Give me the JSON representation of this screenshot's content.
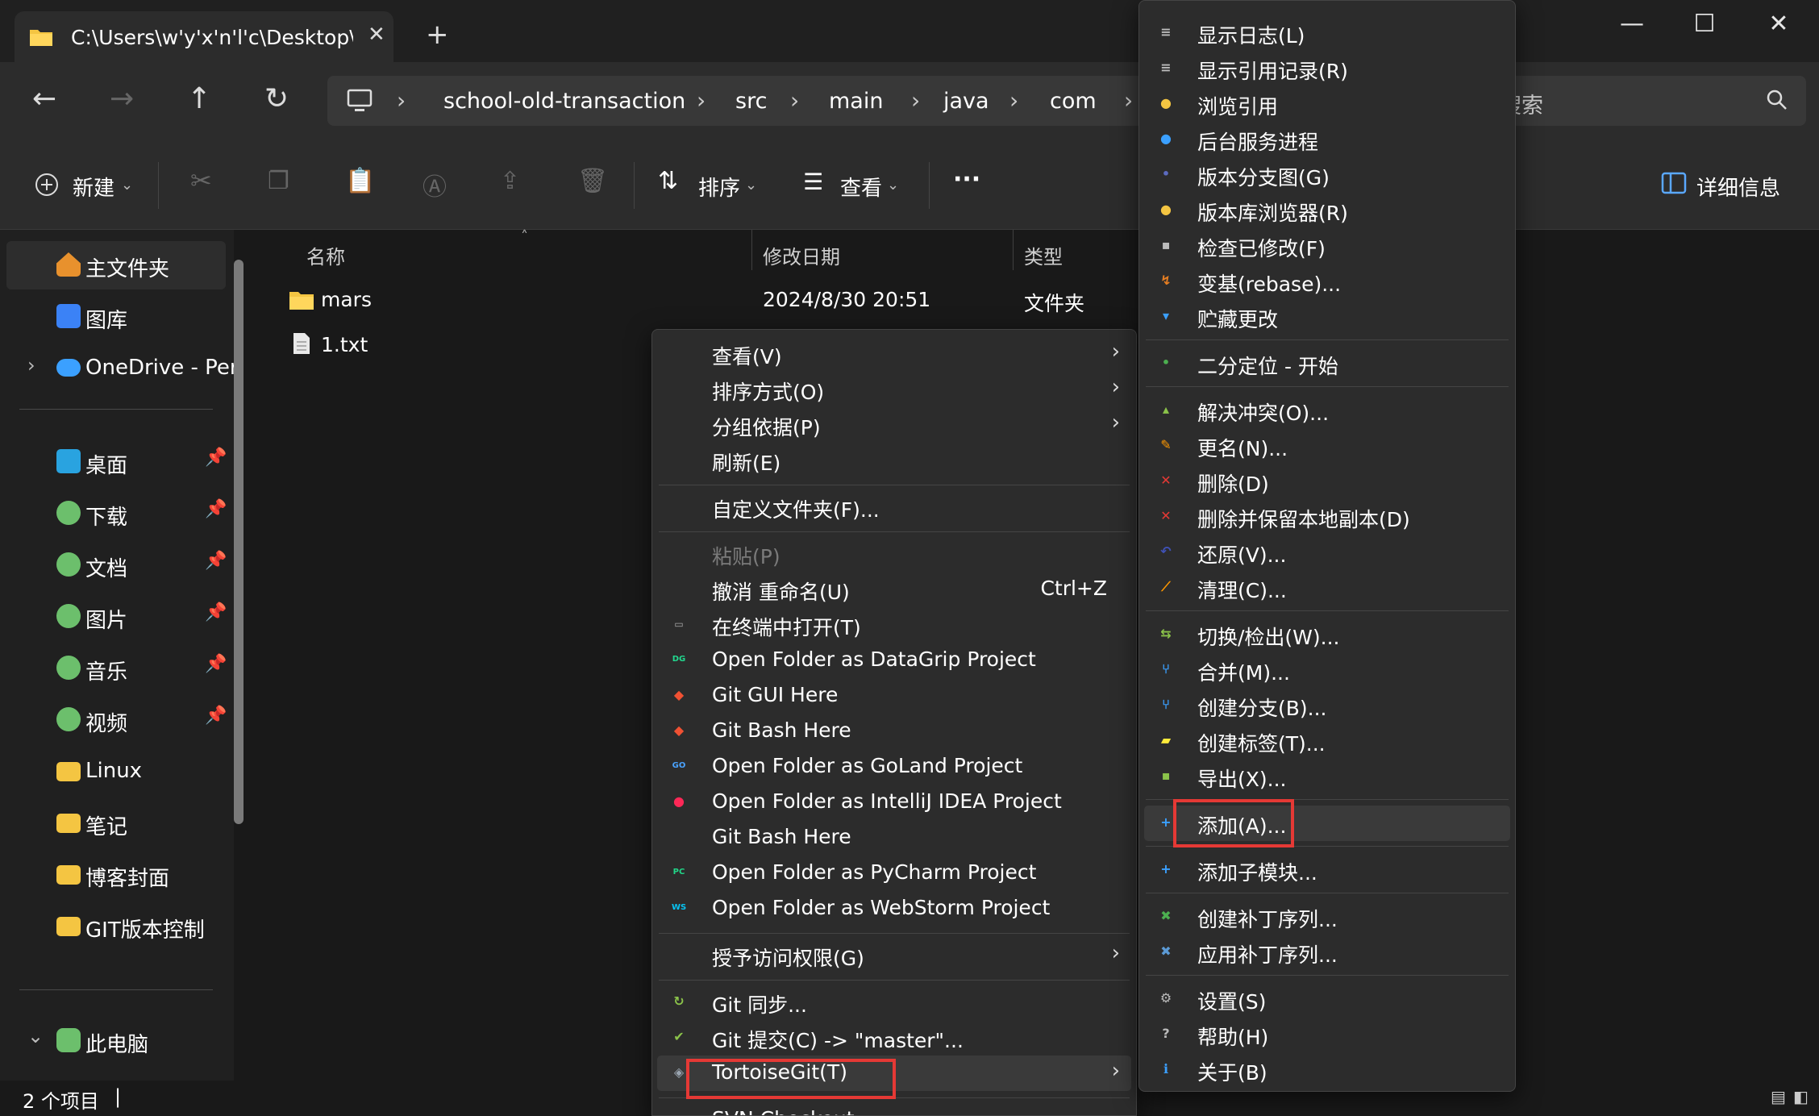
{
  "window": {
    "tab_title": "C:\\Users\\w'y'x'n'l'c\\Desktop\\sc",
    "tab_close": "✕",
    "new_tab": "+",
    "controls": {
      "minimize": "—",
      "maximize": "☐",
      "close": "✕"
    }
  },
  "address": {
    "crumbs": [
      "school-old-transaction",
      "src",
      "main",
      "java",
      "com"
    ],
    "separator": "›",
    "search_placeholder": "搜索"
  },
  "toolbar": {
    "new_label": "新建",
    "sort_label": "排序",
    "view_label": "查看",
    "more_label": "···",
    "details_label": "详细信息"
  },
  "sidebar": {
    "items": [
      {
        "label": "主文件夹",
        "icon": "home-icon"
      },
      {
        "label": "图库",
        "icon": "gallery-icon"
      },
      {
        "label": "OneDrive - Per",
        "icon": "cloud-icon"
      },
      {
        "label": "桌面",
        "icon": "desktop-icon"
      },
      {
        "label": "下载",
        "icon": "download-icon"
      },
      {
        "label": "文档",
        "icon": "document-icon"
      },
      {
        "label": "图片",
        "icon": "picture-icon"
      },
      {
        "label": "音乐",
        "icon": "music-icon"
      },
      {
        "label": "视频",
        "icon": "video-icon"
      },
      {
        "label": "Linux",
        "icon": "folder-icon"
      },
      {
        "label": "笔记",
        "icon": "folder-icon"
      },
      {
        "label": "博客封面",
        "icon": "folder-icon"
      },
      {
        "label": "GIT版本控制",
        "icon": "folder-icon"
      },
      {
        "label": "此电脑",
        "icon": "pc-icon"
      }
    ]
  },
  "files": {
    "columns": {
      "name": "名称",
      "modified": "修改日期",
      "type": "类型"
    },
    "rows": [
      {
        "name": "mars",
        "modified": "2024/8/30 20:51",
        "type": "文件夹",
        "icon": "folder-icon"
      },
      {
        "name": "1.txt",
        "modified": "",
        "type": "",
        "icon": "text-file-icon"
      }
    ]
  },
  "status": {
    "item_count": "2 个项目"
  },
  "context_menu": {
    "items": [
      {
        "label": "查看(V)"
      },
      {
        "label": "排序方式(O)"
      },
      {
        "label": "分组依据(P)"
      },
      {
        "label": "刷新(E)"
      },
      {
        "label": "自定义文件夹(F)..."
      },
      {
        "label": "粘贴(P)"
      },
      {
        "label": "撤消 重命名(U)",
        "shortcut": "Ctrl+Z"
      },
      {
        "label": "在终端中打开(T)"
      },
      {
        "label": "Open Folder as DataGrip Project"
      },
      {
        "label": "Git GUI Here"
      },
      {
        "label": "Git Bash Here"
      },
      {
        "label": "Open Folder as GoLand Project"
      },
      {
        "label": "Open Folder as IntelliJ IDEA Project"
      },
      {
        "label": "Git Bash Here"
      },
      {
        "label": "Open Folder as PyCharm Project"
      },
      {
        "label": "Open Folder as WebStorm Project"
      },
      {
        "label": "授予访问权限(G)"
      },
      {
        "label": "Git 同步..."
      },
      {
        "label": "Git 提交(C) -> \"master\"..."
      },
      {
        "label": "TortoiseGit(T)"
      },
      {
        "label": "SVN Checkout..."
      }
    ]
  },
  "tortoisegit_menu": {
    "items": [
      {
        "label": "显示日志(L)"
      },
      {
        "label": "显示引用记录(R)"
      },
      {
        "label": "浏览引用"
      },
      {
        "label": "后台服务进程"
      },
      {
        "label": "版本分支图(G)"
      },
      {
        "label": "版本库浏览器(R)"
      },
      {
        "label": "检查已修改(F)"
      },
      {
        "label": "变基(rebase)..."
      },
      {
        "label": "贮藏更改"
      },
      {
        "label": "二分定位 - 开始"
      },
      {
        "label": "解决冲突(O)..."
      },
      {
        "label": "更名(N)..."
      },
      {
        "label": "删除(D)"
      },
      {
        "label": "删除并保留本地副本(D)"
      },
      {
        "label": "还原(V)..."
      },
      {
        "label": "清理(C)..."
      },
      {
        "label": "切换/检出(W)..."
      },
      {
        "label": "合并(M)..."
      },
      {
        "label": "创建分支(B)..."
      },
      {
        "label": "创建标签(T)..."
      },
      {
        "label": "导出(X)..."
      },
      {
        "label": "添加(A)..."
      },
      {
        "label": "添加子模块..."
      },
      {
        "label": "创建补丁序列..."
      },
      {
        "label": "应用补丁序列..."
      },
      {
        "label": "设置(S)"
      },
      {
        "label": "帮助(H)"
      },
      {
        "label": "关于(B)"
      }
    ]
  },
  "highlight_color": "#e53935"
}
